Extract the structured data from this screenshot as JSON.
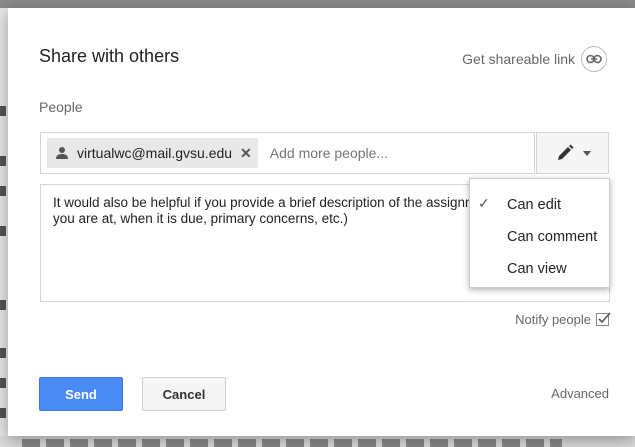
{
  "dialog": {
    "title": "Share with others",
    "shareable_link_label": "Get shareable link",
    "people_label": "People"
  },
  "people": {
    "chips": [
      {
        "email": "virtualwc@mail.gvsu.edu"
      }
    ],
    "add_placeholder": "Add more people..."
  },
  "message": {
    "value": "It would also be helpful if you provide a brief description of the assignment (i.e. what stage you are at, when it is due, primary concerns, etc.)"
  },
  "permission_menu": {
    "items": [
      {
        "label": "Can edit",
        "selected": true
      },
      {
        "label": "Can comment",
        "selected": false
      },
      {
        "label": "Can view",
        "selected": false
      }
    ]
  },
  "notify": {
    "label": "Notify people",
    "checked": true
  },
  "footer": {
    "send_label": "Send",
    "cancel_label": "Cancel",
    "advanced_label": "Advanced"
  },
  "colors": {
    "primary_button": "#4a8af4",
    "text_secondary": "#666666"
  },
  "icons": {
    "person": "person-icon",
    "remove": "close-icon",
    "link": "link-icon",
    "pencil": "pencil-icon",
    "caret": "caret-down-icon",
    "check": "check-icon"
  }
}
